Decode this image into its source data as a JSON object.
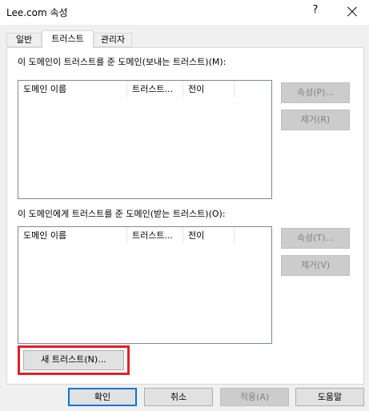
{
  "window": {
    "title": "Lee.com 속성",
    "help": "?"
  },
  "tabs": [
    {
      "label": "일반"
    },
    {
      "label": "트러스트"
    },
    {
      "label": "관리자"
    }
  ],
  "outgoing": {
    "label": "이 도메인이 트러스트를 준 도메인(보내는 트러스트)(M):",
    "columns": [
      "도메인 이름",
      "트러스트...",
      "전이"
    ],
    "properties_button": "속성(P)...",
    "remove_button": "제거(R)"
  },
  "incoming": {
    "label": "이 도메인에게 트러스트를 준 도메인(받는 트러스트)(O):",
    "columns": [
      "도메인 이름",
      "트러스트...",
      "전이"
    ],
    "properties_button": "속성(T)...",
    "remove_button": "제거(V)"
  },
  "new_trust_button": "새 트러스트(N)...",
  "footer": {
    "ok": "확인",
    "cancel": "취소",
    "apply": "적용(A)",
    "help": "도움말"
  },
  "colors": {
    "highlight": "#e0202a",
    "default_button_border": "#0078d7"
  }
}
